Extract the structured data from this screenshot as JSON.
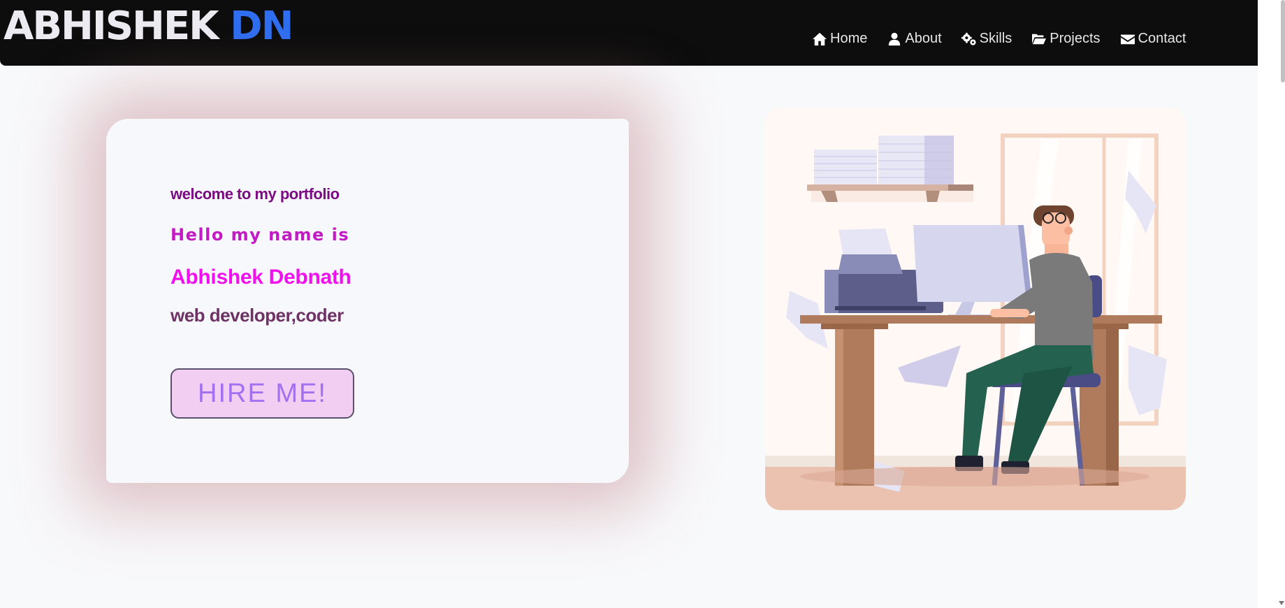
{
  "brand": {
    "first": "ABHISHEK",
    "second": "DN",
    "accent_color": "#2f6ef0"
  },
  "nav": {
    "items": [
      {
        "icon": "home-icon",
        "label": "Home"
      },
      {
        "icon": "user-icon",
        "label": "About"
      },
      {
        "icon": "gears-icon",
        "label": "Skills"
      },
      {
        "icon": "folder-open-icon",
        "label": "Projects"
      },
      {
        "icon": "envelope-icon",
        "label": "Contact"
      }
    ]
  },
  "hero": {
    "welcome": "welcome to my portfolio",
    "hello": "Hello my name is",
    "name": "Abhishek Debnath",
    "role": "web developer,coder",
    "cta_label": "HIRE ME!"
  },
  "colors": {
    "navbar_bg": "#0d0d0d",
    "page_bg": "#f8f9fb",
    "welcome": "#7a0b82",
    "hello": "#c21bc4",
    "name": "#f011ee",
    "role": "#6e3265",
    "button_bg": "#f2cef2",
    "button_text": "#a470f0"
  },
  "illustration": {
    "description_icon": "developer-at-desk-illustration"
  }
}
